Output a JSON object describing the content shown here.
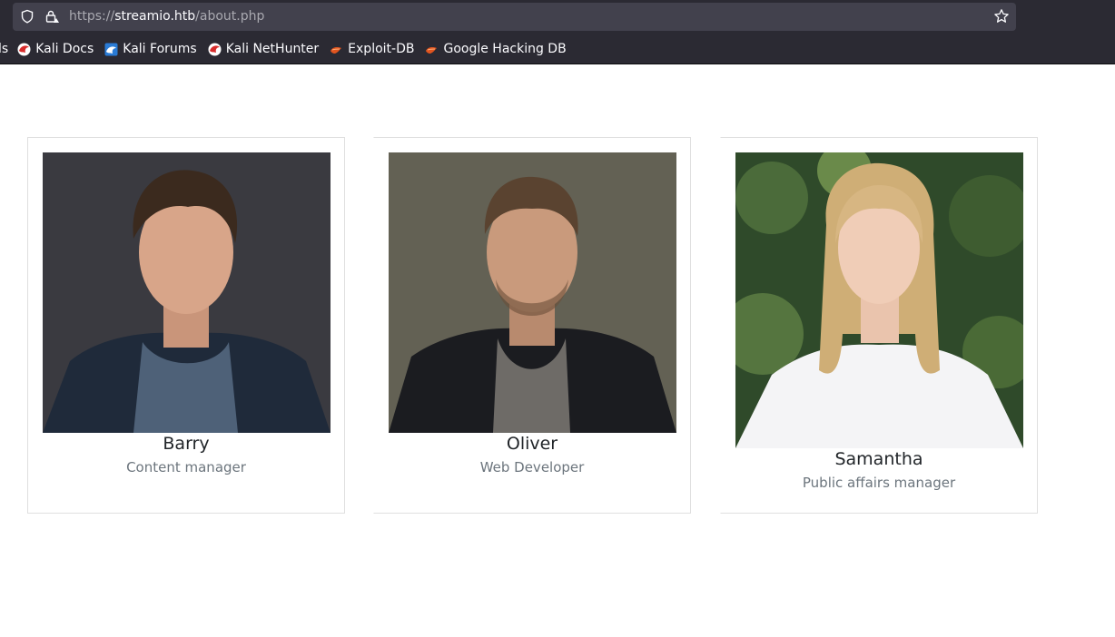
{
  "browser": {
    "url_scheme": "https://",
    "url_host": "streamio.htb",
    "url_path": "/about.php",
    "bookmarks": [
      {
        "label": "ls",
        "icon": "truncated"
      },
      {
        "label": "Kali Docs",
        "icon": "kali-dragon-icon"
      },
      {
        "label": "Kali Forums",
        "icon": "kali-forums-icon"
      },
      {
        "label": "Kali NetHunter",
        "icon": "kali-dragon-icon"
      },
      {
        "label": "Exploit-DB",
        "icon": "exploit-db-icon"
      },
      {
        "label": "Google Hacking DB",
        "icon": "exploit-db-icon"
      }
    ]
  },
  "team": [
    {
      "name": "Barry",
      "role": "Content manager"
    },
    {
      "name": "Oliver",
      "role": "Web Developer"
    },
    {
      "name": "Samantha",
      "role": "Public affairs manager"
    }
  ],
  "colors": {
    "chrome_bg": "#2b2a33",
    "urlbar_bg": "#42414d",
    "card_border": "#dfdfdf",
    "name_text": "#212529",
    "role_text": "#6c757d"
  }
}
